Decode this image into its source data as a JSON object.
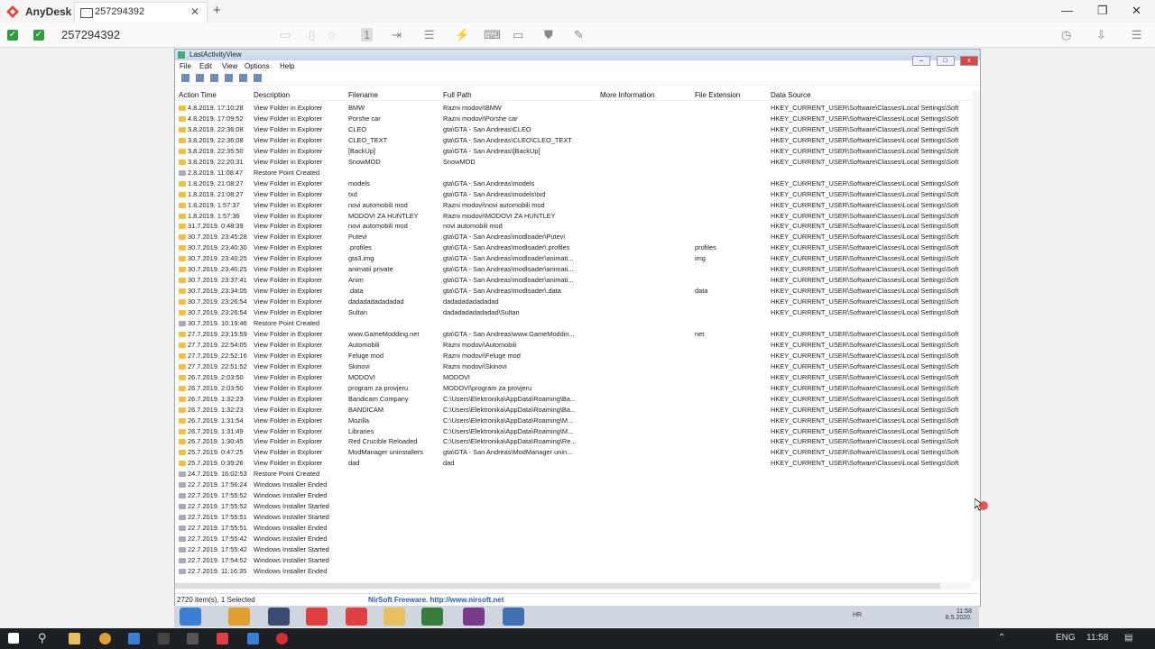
{
  "anydesk": {
    "app_name": "AnyDesk",
    "tab_label": "257294392",
    "address": "257294392",
    "colors": {
      "brand": "#ef443b",
      "check": "#2e9c3f"
    }
  },
  "lav": {
    "title": "LastActivityView",
    "menu": [
      "File",
      "Edit",
      "View",
      "Options",
      "Help"
    ],
    "columns": [
      "Action Time",
      "Description",
      "Filename",
      "Full Path",
      "More Information",
      "File Extension",
      "Data Source"
    ],
    "rows": [
      [
        "4.8.2019. 17:10:28",
        "View Folder in Explorer",
        "BMW",
        "Razni modovi\\BMW",
        "",
        "",
        "HKEY_CURRENT_USER\\Software\\Classes\\Local Settings\\Soft"
      ],
      [
        "4.8.2019. 17:09:52",
        "View Folder in Explorer",
        "Porshe car",
        "Razni modovi\\Porshe car",
        "",
        "",
        "HKEY_CURRENT_USER\\Software\\Classes\\Local Settings\\Soft"
      ],
      [
        "3.8.2019. 22:36:08",
        "View Folder in Explorer",
        "CLEO",
        "gta\\GTA - San Andreas\\CLEO",
        "",
        "",
        "HKEY_CURRENT_USER\\Software\\Classes\\Local Settings\\Soft"
      ],
      [
        "3.8.2019. 22:36:08",
        "View Folder in Explorer",
        "CLEO_TEXT",
        "gta\\GTA - San Andreas\\CLEO\\CLEO_TEXT",
        "",
        "",
        "HKEY_CURRENT_USER\\Software\\Classes\\Local Settings\\Soft"
      ],
      [
        "3.8.2019. 22:35:50",
        "View Folder in Explorer",
        "[BackUp]",
        "gta\\GTA - San Andreas\\[BackUp]",
        "",
        "",
        "HKEY_CURRENT_USER\\Software\\Classes\\Local Settings\\Soft"
      ],
      [
        "3.8.2019. 22:20:31",
        "View Folder in Explorer",
        "SnowMOD",
        "SnowMOD",
        "",
        "",
        "HKEY_CURRENT_USER\\Software\\Classes\\Local Settings\\Soft"
      ],
      [
        "2.8.2019. 11:08:47",
        "Restore Point Created",
        "",
        "",
        "",
        "",
        ""
      ],
      [
        "1.8.2019. 21:08:27",
        "View Folder in Explorer",
        "models",
        "gta\\GTA - San Andreas\\models",
        "",
        "",
        "HKEY_CURRENT_USER\\Software\\Classes\\Local Settings\\Soft"
      ],
      [
        "1.8.2019. 21:08:27",
        "View Folder in Explorer",
        "txd",
        "gta\\GTA - San Andreas\\models\\txd",
        "",
        "",
        "HKEY_CURRENT_USER\\Software\\Classes\\Local Settings\\Soft"
      ],
      [
        "1.8.2019. 1:57:37",
        "View Folder in Explorer",
        "novi automobili mod",
        "Razni modovi\\novi automobili mod",
        "",
        "",
        "HKEY_CURRENT_USER\\Software\\Classes\\Local Settings\\Soft"
      ],
      [
        "1.8.2019. 1:57:36",
        "View Folder in Explorer",
        "MODOVI ZA HUNTLEY",
        "Razni modovi\\MODOVI ZA HUNTLEY",
        "",
        "",
        "HKEY_CURRENT_USER\\Software\\Classes\\Local Settings\\Soft"
      ],
      [
        "31.7.2019. 0:48:39",
        "View Folder in Explorer",
        "novi automobili mod",
        "novi automobili mod",
        "",
        "",
        "HKEY_CURRENT_USER\\Software\\Classes\\Local Settings\\Soft"
      ],
      [
        "30.7.2019. 23:45:28",
        "View Folder in Explorer",
        "Putevi",
        "gta\\GTA - San Andreas\\modloader\\Putevi",
        "",
        "",
        "HKEY_CURRENT_USER\\Software\\Classes\\Local Settings\\Soft"
      ],
      [
        "30.7.2019. 23:40:30",
        "View Folder in Explorer",
        ".profiles",
        "gta\\GTA - San Andreas\\modloader\\.profiles",
        "",
        "profiles",
        "HKEY_CURRENT_USER\\Software\\Classes\\Local Settings\\Soft"
      ],
      [
        "30.7.2019. 23:40:25",
        "View Folder in Explorer",
        "gta3.img",
        "gta\\GTA - San Andreas\\modloader\\animati...",
        "",
        "img",
        "HKEY_CURRENT_USER\\Software\\Classes\\Local Settings\\Soft"
      ],
      [
        "30.7.2019. 23:40:25",
        "View Folder in Explorer",
        "animatii private",
        "gta\\GTA - San Andreas\\modloader\\animati...",
        "",
        "",
        "HKEY_CURRENT_USER\\Software\\Classes\\Local Settings\\Soft"
      ],
      [
        "30.7.2019. 23:37:41",
        "View Folder in Explorer",
        "Anim",
        "gta\\GTA - San Andreas\\modloader\\animati...",
        "",
        "",
        "HKEY_CURRENT_USER\\Software\\Classes\\Local Settings\\Soft"
      ],
      [
        "30.7.2019. 23:34:05",
        "View Folder in Explorer",
        ".data",
        "gta\\GTA - San Andreas\\modloader\\.data",
        "",
        "data",
        "HKEY_CURRENT_USER\\Software\\Classes\\Local Settings\\Soft"
      ],
      [
        "30.7.2019. 23:26:54",
        "View Folder in Explorer",
        "dadadadadadadad",
        "dadadadadadadad",
        "",
        "",
        "HKEY_CURRENT_USER\\Software\\Classes\\Local Settings\\Soft"
      ],
      [
        "30.7.2019. 23:26:54",
        "View Folder in Explorer",
        "Sultan",
        "dadadadadadadad\\Sultan",
        "",
        "",
        "HKEY_CURRENT_USER\\Software\\Classes\\Local Settings\\Soft"
      ],
      [
        "30.7.2019. 10:19:46",
        "Restore Point Created",
        "",
        "",
        "",
        "",
        ""
      ],
      [
        "27.7.2019. 23:15:59",
        "View Folder in Explorer",
        "www.GameModding.net",
        "gta\\GTA - San Andreas\\www.GameModdin...",
        "",
        "net",
        "HKEY_CURRENT_USER\\Software\\Classes\\Local Settings\\Soft"
      ],
      [
        "27.7.2019. 22:54:05",
        "View Folder in Explorer",
        "Automobili",
        "Razni modovi\\Automobili",
        "",
        "",
        "HKEY_CURRENT_USER\\Software\\Classes\\Local Settings\\Soft"
      ],
      [
        "27.7.2019. 22:52:16",
        "View Folder in Explorer",
        "Feluge mod",
        "Razni modovi\\Feluge mod",
        "",
        "",
        "HKEY_CURRENT_USER\\Software\\Classes\\Local Settings\\Soft"
      ],
      [
        "27.7.2019. 22:51:52",
        "View Folder in Explorer",
        "Skinovi",
        "Razni modovi\\Skinovi",
        "",
        "",
        "HKEY_CURRENT_USER\\Software\\Classes\\Local Settings\\Soft"
      ],
      [
        "26.7.2019. 2:03:50",
        "View Folder in Explorer",
        "MODOVI",
        "MODOVI",
        "",
        "",
        "HKEY_CURRENT_USER\\Software\\Classes\\Local Settings\\Soft"
      ],
      [
        "26.7.2019. 2:03:50",
        "View Folder in Explorer",
        "program za provjeru",
        "MODOVI\\program za provjeru",
        "",
        "",
        "HKEY_CURRENT_USER\\Software\\Classes\\Local Settings\\Soft"
      ],
      [
        "26.7.2019. 1:32:23",
        "View Folder in Explorer",
        "Bandicam Company",
        "C:\\Users\\Elektronika\\AppData\\Roaming\\Ba...",
        "",
        "",
        "HKEY_CURRENT_USER\\Software\\Classes\\Local Settings\\Soft"
      ],
      [
        "26.7.2019. 1:32:23",
        "View Folder in Explorer",
        "BANDICAM",
        "C:\\Users\\Elektronika\\AppData\\Roaming\\Ba...",
        "",
        "",
        "HKEY_CURRENT_USER\\Software\\Classes\\Local Settings\\Soft"
      ],
      [
        "26.7.2019. 1:31:54",
        "View Folder in Explorer",
        "Mozilla",
        "C:\\Users\\Elektronika\\AppData\\Roaming\\M...",
        "",
        "",
        "HKEY_CURRENT_USER\\Software\\Classes\\Local Settings\\Soft"
      ],
      [
        "26.7.2019. 1:31:49",
        "View Folder in Explorer",
        "Libraries",
        "C:\\Users\\Elektronika\\AppData\\Roaming\\M...",
        "",
        "",
        "HKEY_CURRENT_USER\\Software\\Classes\\Local Settings\\Soft"
      ],
      [
        "26.7.2019. 1:30:45",
        "View Folder in Explorer",
        "Red Crucible Reloaded",
        "C:\\Users\\Elektronika\\AppData\\Roaming\\Re...",
        "",
        "",
        "HKEY_CURRENT_USER\\Software\\Classes\\Local Settings\\Soft"
      ],
      [
        "25.7.2019. 0:47:25",
        "View Folder in Explorer",
        "ModManager uninstallers",
        "gta\\GTA - San Andreas\\ModManager unin...",
        "",
        "",
        "HKEY_CURRENT_USER\\Software\\Classes\\Local Settings\\Soft"
      ],
      [
        "25.7.2019. 0:39:26",
        "View Folder in Explorer",
        "dad",
        "dad",
        "",
        "",
        "HKEY_CURRENT_USER\\Software\\Classes\\Local Settings\\Soft"
      ],
      [
        "24.7.2019. 16:02:53",
        "Restore Point Created",
        "",
        "",
        "",
        "",
        ""
      ],
      [
        "22.7.2019. 17:56:24",
        "Windows Installer Ended",
        "",
        "",
        "",
        "",
        ""
      ],
      [
        "22.7.2019. 17:55:52",
        "Windows Installer Ended",
        "",
        "",
        "",
        "",
        ""
      ],
      [
        "22.7.2019. 17:55:52",
        "Windows Installer Started",
        "",
        "",
        "",
        "",
        ""
      ],
      [
        "22.7.2019. 17:55:51",
        "Windows Installer Started",
        "",
        "",
        "",
        "",
        ""
      ],
      [
        "22.7.2019. 17:55:51",
        "Windows Installer Ended",
        "",
        "",
        "",
        "",
        ""
      ],
      [
        "22.7.2019. 17:55:42",
        "Windows Installer Ended",
        "",
        "",
        "",
        "",
        ""
      ],
      [
        "22.7.2019. 17:55:42",
        "Windows Installer Started",
        "",
        "",
        "",
        "",
        ""
      ],
      [
        "22.7.2019. 17:54:52",
        "Windows Installer Started",
        "",
        "",
        "",
        "",
        ""
      ],
      [
        "22.7.2019. 11:16:35",
        "Windows Installer Ended",
        "",
        "",
        "",
        "",
        ""
      ]
    ],
    "status_count": "2720 item(s), 1 Selected",
    "status_link": "NirSoft Freeware.  http://www.nirsoft.net"
  },
  "remote_taskbar": {
    "lang": "HR",
    "time": "11:58",
    "date": "8.5.2020."
  },
  "windows_taskbar": {
    "lang": "ENG",
    "time": "11:58"
  }
}
